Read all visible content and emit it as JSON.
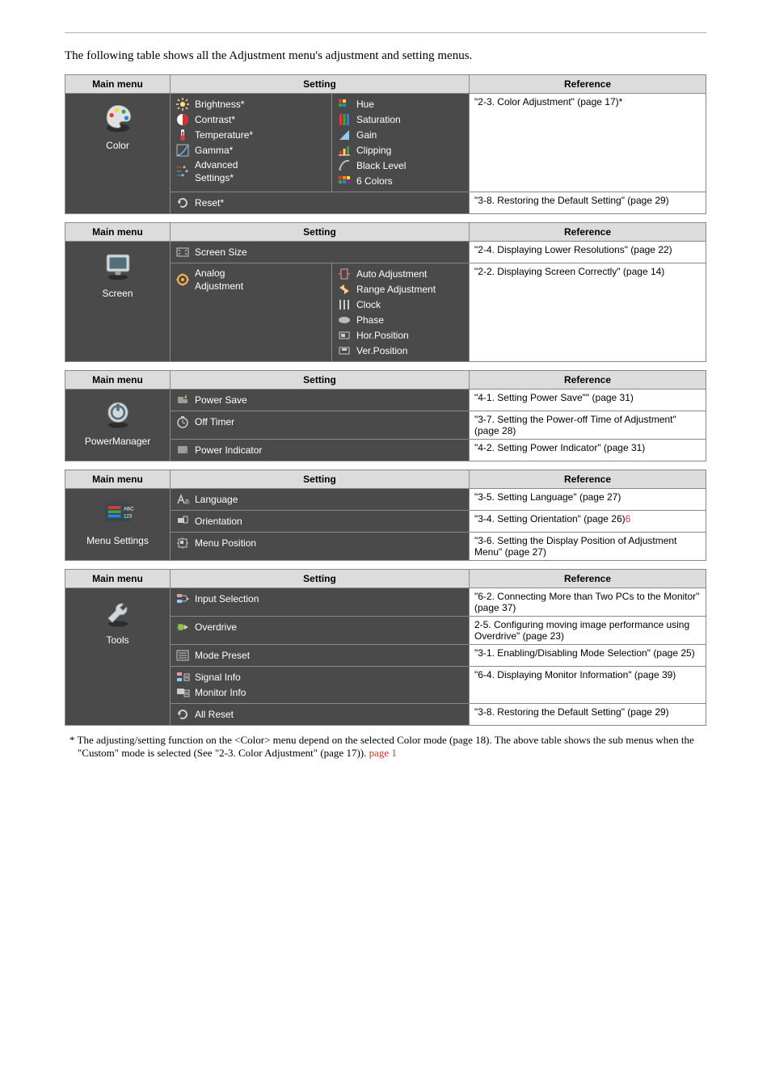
{
  "intro": "The following table shows all the Adjustment menu's adjustment and setting menus.",
  "headers": {
    "main": "Main menu",
    "setting": "Setting",
    "ref": "Reference"
  },
  "color": {
    "cat": "Color",
    "items": [
      "Brightness*",
      "Contrast*",
      "Temperature*",
      "Gamma*",
      "Advanced\nSettings*",
      "Reset*"
    ],
    "adv": [
      "Hue",
      "Saturation",
      "Gain",
      "Clipping",
      "Black Level",
      "6 Colors"
    ],
    "refs": [
      "\"2-3. Color Adjustment\" (page 17)*",
      "\"3-8. Restoring the Default Setting\" (page 29)"
    ]
  },
  "screen": {
    "cat": "Screen",
    "items": [
      "Screen Size",
      "Analog\nAdjustment"
    ],
    "adv": [
      "Auto Adjustment",
      "Range Adjustment",
      "Clock",
      "Phase",
      "Hor.Position",
      "Ver.Position"
    ],
    "refs": [
      "\"2-4. Displaying Lower Resolutions\" (page 22)",
      "\"2-2. Displaying Screen Correctly\" (page 14)"
    ]
  },
  "power": {
    "cat": "PowerManager",
    "items": [
      "Power Save",
      "Off Timer",
      "Power Indicator"
    ],
    "refs": [
      "\"4-1. Setting Power Save\"\" (page 31)",
      "\"3-7. Setting the Power-off Time of Adjustment\" (page 28)",
      "\"4-2. Setting Power Indicator\" (page 31)"
    ]
  },
  "menusettings": {
    "cat": "Menu Settings",
    "items": [
      "Language",
      "Orientation",
      "Menu Position"
    ],
    "refs": [
      "\"3-5. Setting Language\" (page 27)",
      "\"3-4. Setting Orientation\" (page 26)",
      "\"3-6. Setting the Display Position of Adjustment Menu\" (page 27)"
    ]
  },
  "tools": {
    "cat": "Tools",
    "items": [
      "Input Selection",
      "Overdrive",
      "Mode Preset",
      "Signal Info",
      "Monitor Info",
      "All Reset"
    ],
    "refs": [
      "\"6-2. Connecting More than Two PCs to the Monitor\" (page 37)",
      " 2-5. Configuring moving image performance using Overdrive\" (page 23)",
      "\"3-1. Enabling/Disabling Mode Selection\" (page 25)",
      "\"6-4. Displaying Monitor Information\" (page 39)",
      "\"3-8. Restoring the Default Setting\" (page 29)"
    ]
  },
  "foot1": "* The adjusting/setting function on the <Color> menu depend on the selected Color mode (page 18). The above table shows the sub menus when the \"Custom\" mode is selected (See \"2-3. Color Adjustment\" (page 17))."
}
